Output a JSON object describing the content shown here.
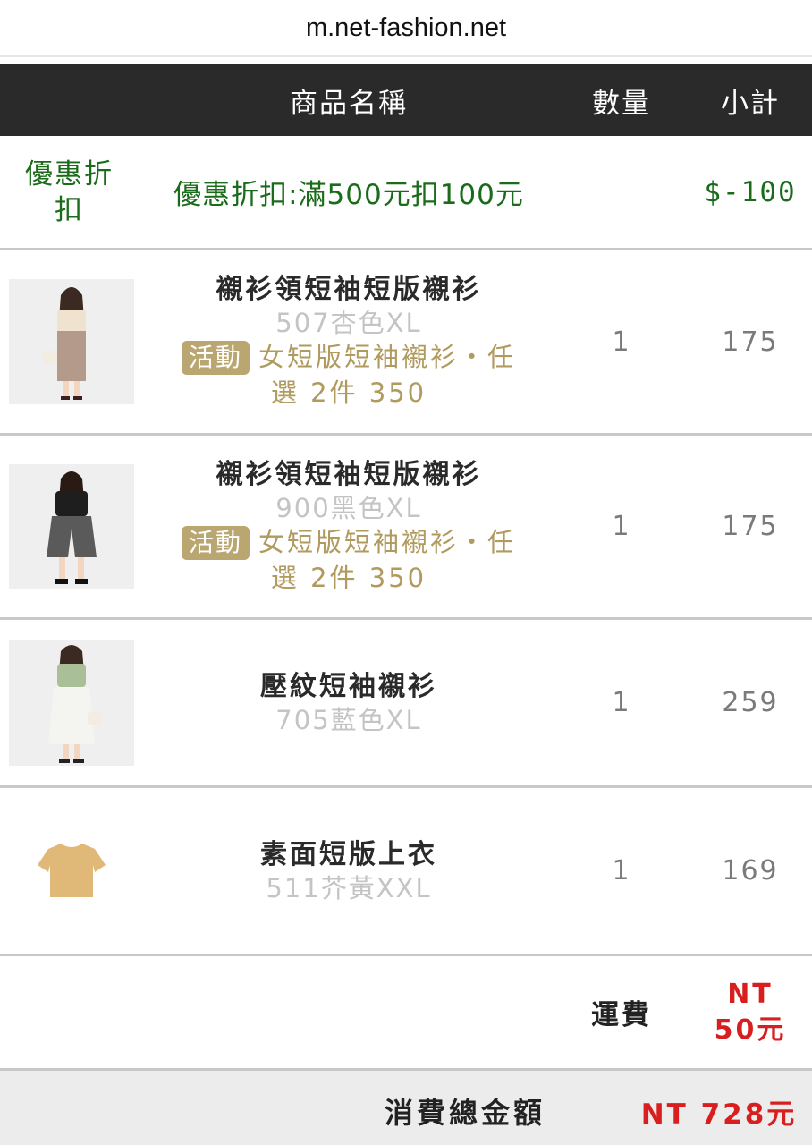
{
  "browser": {
    "url": "m.net-fashion.net"
  },
  "table_header": {
    "product": "商品名稱",
    "qty": "數量",
    "subtotal": "小計"
  },
  "discount": {
    "label": "優惠折扣",
    "label_line1": "優惠折",
    "label_line2": "扣",
    "name": "優惠折扣:滿500元扣100元",
    "amount": "$-100"
  },
  "items": [
    {
      "name": "襯衫領短袖短版襯衫",
      "variant": "507杏色XL",
      "badge": "活動",
      "promo_line1": "女短版短袖襯衫・任",
      "promo_line2": "選 2件 350",
      "qty": "1",
      "subtotal": "175",
      "thumb": {
        "type": "model-photo",
        "top": "#efe2cf",
        "bottom": "#b49a8a"
      }
    },
    {
      "name": "襯衫領短袖短版襯衫",
      "variant": "900黑色XL",
      "badge": "活動",
      "promo_line1": "女短版短袖襯衫・任",
      "promo_line2": "選 2件 350",
      "qty": "1",
      "subtotal": "175",
      "thumb": {
        "type": "model-photo",
        "top": "#1e1e1e",
        "bottom": "#5a5a5a"
      }
    },
    {
      "name": "壓紋短袖襯衫",
      "variant": "705藍色XL",
      "qty": "1",
      "subtotal": "259",
      "thumb": {
        "type": "model-photo",
        "top": "#a9bf98",
        "bottom": "#f4f4f0"
      }
    },
    {
      "name": "素面短版上衣",
      "variant": "511芥黃XXL",
      "qty": "1",
      "subtotal": "169",
      "thumb": {
        "type": "flat-tshirt",
        "top": "#e0b979"
      }
    }
  ],
  "shipping": {
    "label": "運費",
    "amount_line1": "NT",
    "amount_line2": "50元"
  },
  "total": {
    "label": "消費總金額",
    "amount": "NT 728元"
  },
  "colors": {
    "header_bg": "#2a2a2a",
    "discount_green": "#1a6b1a",
    "promo_gold": "#b09a5e",
    "badge_bg": "#b9a670",
    "price_red": "#d81e1e",
    "total_bg": "#ececec"
  }
}
